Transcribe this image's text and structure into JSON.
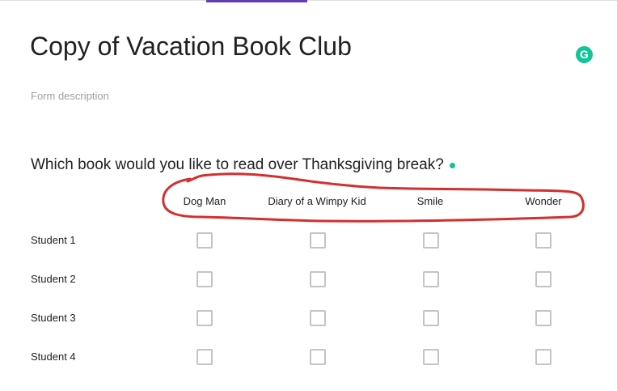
{
  "form": {
    "title": "Copy of Vacation Book Club",
    "description_placeholder": "Form description"
  },
  "question": {
    "title": "Which book would you like to read over Thanksgiving break?",
    "columns": [
      "Dog Man",
      "Diary of a Wimpy Kid",
      "Smile",
      "Wonder"
    ],
    "rows": [
      "Student 1",
      "Student 2",
      "Student 3",
      "Student 4"
    ]
  },
  "icons": {
    "grammarly": "grammarly-icon",
    "grammarly_letter": "G"
  },
  "colors": {
    "accent": "#673ab7",
    "grammarly": "#15c39a",
    "annotation": "#d32f2f",
    "checkbox_border": "#c4c4c4"
  }
}
